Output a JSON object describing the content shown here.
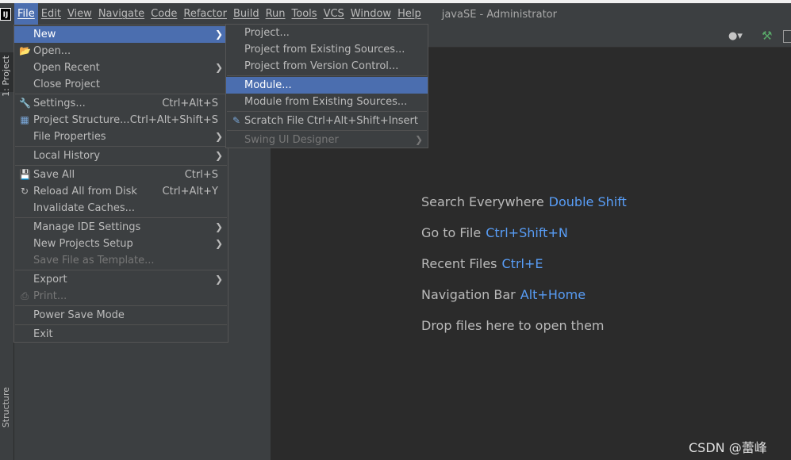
{
  "window": {
    "title": "javaSE - Administrator",
    "app_icon_text": "IJ"
  },
  "menubar": {
    "items": [
      "File",
      "Edit",
      "View",
      "Navigate",
      "Code",
      "Refactor",
      "Build",
      "Run",
      "Tools",
      "VCS",
      "Window",
      "Help"
    ],
    "active": "File"
  },
  "file_menu": {
    "items": [
      {
        "label": "New",
        "submenu": true,
        "selected": true
      },
      {
        "label": "Open...",
        "icon": "folder-icon"
      },
      {
        "label": "Open Recent",
        "submenu": true
      },
      {
        "label": "Close Project"
      },
      {
        "label": "Settings...",
        "shortcut": "Ctrl+Alt+S",
        "icon": "wrench-icon"
      },
      {
        "label": "Project Structure...",
        "shortcut": "Ctrl+Alt+Shift+S",
        "icon": "project-structure-icon"
      },
      {
        "label": "File Properties",
        "submenu": true
      },
      {
        "label": "Local History",
        "submenu": true
      },
      {
        "label": "Save All",
        "shortcut": "Ctrl+S",
        "icon": "save-icon"
      },
      {
        "label": "Reload All from Disk",
        "shortcut": "Ctrl+Alt+Y",
        "icon": "reload-icon"
      },
      {
        "label": "Invalidate Caches..."
      },
      {
        "label": "Manage IDE Settings",
        "submenu": true
      },
      {
        "label": "New Projects Setup",
        "submenu": true
      },
      {
        "label": "Save File as Template...",
        "disabled": true
      },
      {
        "label": "Export",
        "submenu": true
      },
      {
        "label": "Print...",
        "disabled": true,
        "icon": "print-icon"
      },
      {
        "label": "Power Save Mode"
      },
      {
        "label": "Exit"
      }
    ]
  },
  "new_menu": {
    "items": [
      {
        "label": "Project..."
      },
      {
        "label": "Project from Existing Sources..."
      },
      {
        "label": "Project from Version Control..."
      },
      {
        "label": "Module...",
        "selected": true
      },
      {
        "label": "Module from Existing Sources..."
      },
      {
        "label": "Scratch File",
        "shortcut": "Ctrl+Alt+Shift+Insert",
        "icon": "scratch-file-icon"
      },
      {
        "label": "Swing UI Designer",
        "submenu": true,
        "disabled": true
      }
    ]
  },
  "side_stripe": {
    "project": "1: Project",
    "structure": "Structure"
  },
  "welcome_hints": [
    {
      "text": "Search Everywhere",
      "shortcut": "Double Shift"
    },
    {
      "text": "Go to File",
      "shortcut": "Ctrl+Shift+N"
    },
    {
      "text": "Recent Files",
      "shortcut": "Ctrl+E"
    },
    {
      "text": "Navigation Bar",
      "shortcut": "Alt+Home"
    },
    {
      "text": "Drop files here to open them",
      "shortcut": ""
    }
  ],
  "watermark": "CSDN @蕾峰",
  "colors": {
    "selection": "#4b6eaf",
    "shortcut_blue": "#589df6",
    "panel": "#3c3f41",
    "editor": "#2b2b2b"
  }
}
